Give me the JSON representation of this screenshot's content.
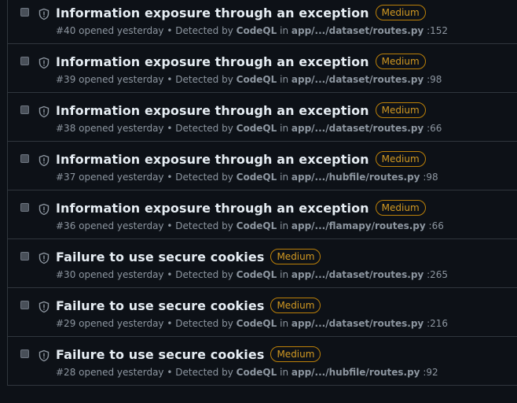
{
  "alerts": [
    {
      "title": "Information exposure through an exception",
      "severity": "Medium",
      "number": "#40",
      "opened": "opened yesterday",
      "detected_by_label": "Detected by",
      "tool": "CodeQL",
      "in_label": "in",
      "path": "app/.../dataset/routes.py",
      "line": ":152"
    },
    {
      "title": "Information exposure through an exception",
      "severity": "Medium",
      "number": "#39",
      "opened": "opened yesterday",
      "detected_by_label": "Detected by",
      "tool": "CodeQL",
      "in_label": "in",
      "path": "app/.../dataset/routes.py",
      "line": ":98"
    },
    {
      "title": "Information exposure through an exception",
      "severity": "Medium",
      "number": "#38",
      "opened": "opened yesterday",
      "detected_by_label": "Detected by",
      "tool": "CodeQL",
      "in_label": "in",
      "path": "app/.../dataset/routes.py",
      "line": ":66"
    },
    {
      "title": "Information exposure through an exception",
      "severity": "Medium",
      "number": "#37",
      "opened": "opened yesterday",
      "detected_by_label": "Detected by",
      "tool": "CodeQL",
      "in_label": "in",
      "path": "app/.../hubfile/routes.py",
      "line": ":98"
    },
    {
      "title": "Information exposure through an exception",
      "severity": "Medium",
      "number": "#36",
      "opened": "opened yesterday",
      "detected_by_label": "Detected by",
      "tool": "CodeQL",
      "in_label": "in",
      "path": "app/.../flamapy/routes.py",
      "line": ":66"
    },
    {
      "title": "Failure to use secure cookies",
      "severity": "Medium",
      "number": "#30",
      "opened": "opened yesterday",
      "detected_by_label": "Detected by",
      "tool": "CodeQL",
      "in_label": "in",
      "path": "app/.../dataset/routes.py",
      "line": ":265"
    },
    {
      "title": "Failure to use secure cookies",
      "severity": "Medium",
      "number": "#29",
      "opened": "opened yesterday",
      "detected_by_label": "Detected by",
      "tool": "CodeQL",
      "in_label": "in",
      "path": "app/.../dataset/routes.py",
      "line": ":216"
    },
    {
      "title": "Failure to use secure cookies",
      "severity": "Medium",
      "number": "#28",
      "opened": "opened yesterday",
      "detected_by_label": "Detected by",
      "tool": "CodeQL",
      "in_label": "in",
      "path": "app/.../hubfile/routes.py",
      "line": ":92"
    }
  ],
  "icons": {
    "alert_icon": "shield-icon"
  },
  "colors": {
    "background": "#0d1117",
    "badge_medium": "#d29922",
    "meta_text": "#8d96a0",
    "border": "#30363d"
  }
}
